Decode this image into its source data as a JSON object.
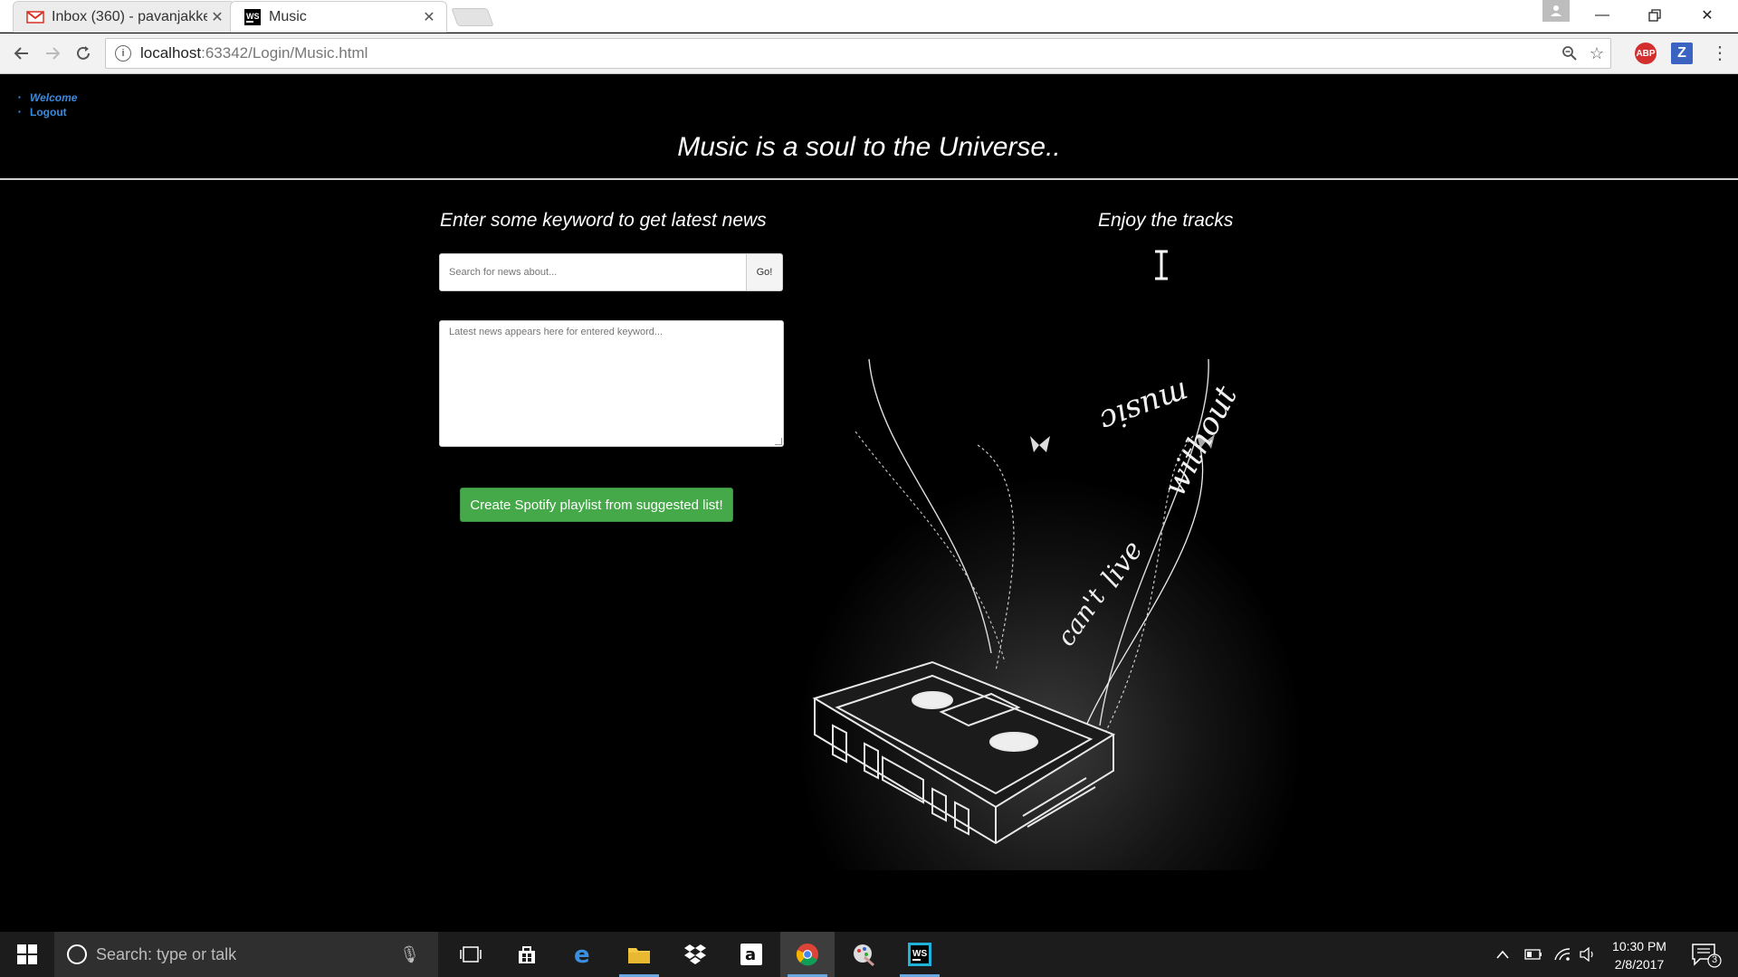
{
  "browser": {
    "tabs": [
      {
        "title": "Inbox (360) - pavanjakke",
        "active": false,
        "icon": "gmail-icon"
      },
      {
        "title": "Music",
        "active": true,
        "icon": "webstorm-icon"
      }
    ],
    "url_host": "localhost",
    "url_rest": ":63342/Login/Music.html",
    "extensions": [
      {
        "name": "adblock-plus",
        "label": "ABP"
      },
      {
        "name": "zotero",
        "label": "Z"
      }
    ]
  },
  "page": {
    "nav": [
      {
        "label": "Welcome"
      },
      {
        "label": "Logout"
      }
    ],
    "title": "Music is a soul to the Universe..",
    "news": {
      "heading": "Enter some keyword to get latest news",
      "search_placeholder": "Search for news about...",
      "go_label": "Go!",
      "results_placeholder": "Latest news appears here for entered keyword..."
    },
    "spotify_button": "Create Spotify playlist from suggested list!",
    "tracks_heading": "Enjoy the tracks",
    "art_text": {
      "line1": "can't",
      "line2": "live",
      "line3": "without",
      "line4": "music"
    }
  },
  "taskbar": {
    "search_placeholder": "Search: type or talk",
    "time": "10:30 PM",
    "date": "2/8/2017",
    "notification_count": "3"
  },
  "colors": {
    "page_bg": "#000000",
    "link": "#3a8bdf",
    "spotify_green": "#45a849",
    "taskbar_bg": "#1c1c1c"
  }
}
